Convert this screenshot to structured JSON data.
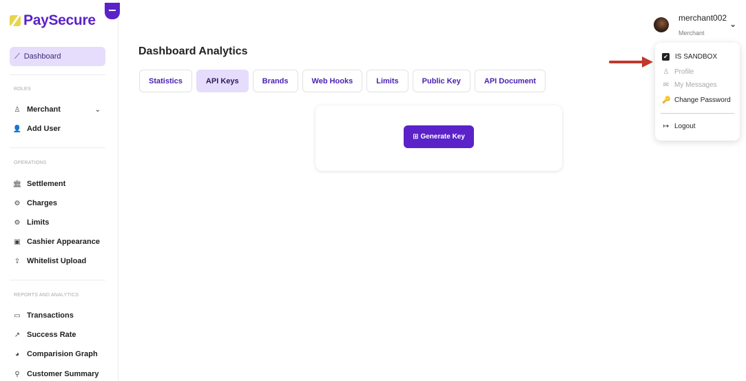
{
  "brand": {
    "name": "PaySecure"
  },
  "sidebar": {
    "dashboard_label": "Dashboard",
    "sections": {
      "roles": "ROLES",
      "operations": "OPERATIONS",
      "reports": "REPORTS AND ANALYTICS"
    },
    "roles_items": [
      {
        "label": "Merchant",
        "icon": "user-icon"
      },
      {
        "label": "Add User",
        "icon": "add-user-icon"
      }
    ],
    "operations_items": [
      {
        "label": "Settlement",
        "icon": "bank-icon"
      },
      {
        "label": "Charges",
        "icon": "gear-badge-icon"
      },
      {
        "label": "Limits",
        "icon": "gear-badge-icon"
      },
      {
        "label": "Cashier Appearance",
        "icon": "cash-icon"
      },
      {
        "label": "Whitelist Upload",
        "icon": "upload-icon"
      }
    ],
    "reports_items": [
      {
        "label": "Transactions",
        "icon": "card-icon"
      },
      {
        "label": "Success Rate",
        "icon": "trend-icon"
      },
      {
        "label": "Comparision Graph",
        "icon": "pie-icon"
      },
      {
        "label": "Customer Summary",
        "icon": "search-icon"
      }
    ]
  },
  "main": {
    "title": "Dashboard Analytics",
    "tabs": [
      {
        "label": "Statistics",
        "active": false
      },
      {
        "label": "API Keys",
        "active": true
      },
      {
        "label": "Brands",
        "active": false
      },
      {
        "label": "Web Hooks",
        "active": false
      },
      {
        "label": "Limits",
        "active": false
      },
      {
        "label": "Public Key",
        "active": false
      },
      {
        "label": "API Document",
        "active": false
      }
    ],
    "generate_button": "Generate Key"
  },
  "user": {
    "name": "merchant002",
    "role": "Merchant"
  },
  "dropdown": {
    "sandbox_label": "IS SANDBOX",
    "sandbox_checked": true,
    "profile": "Profile",
    "messages": "My Messages",
    "change_password": "Change Password",
    "logout": "Logout"
  },
  "colors": {
    "brand": "#5b22c9",
    "active_bg": "#e6dcfb",
    "annotation_arrow": "#c0392b"
  }
}
